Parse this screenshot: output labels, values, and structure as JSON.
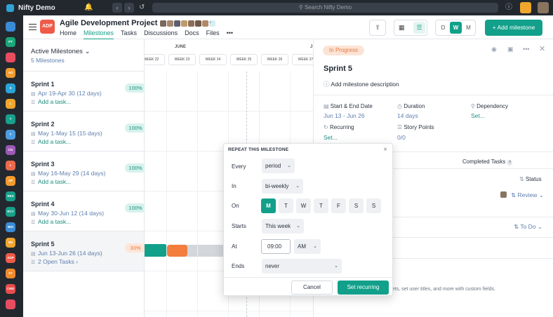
{
  "app": {
    "title": "Nifty Demo",
    "search_placeholder": "Search Nifty Demo"
  },
  "rail": [
    {
      "label": "",
      "color": "#3a8bd6"
    },
    {
      "label": "PT",
      "color": "#1ba679"
    },
    {
      "label": "",
      "color": "#e84c61"
    },
    {
      "label": "AD",
      "color": "#f09b2d"
    },
    {
      "label": "S",
      "color": "#2aa4d6"
    },
    {
      "label": "L",
      "color": "#f0a52d"
    },
    {
      "label": "T",
      "color": "#17a08a"
    },
    {
      "label": "Y",
      "color": "#4d9de0"
    },
    {
      "label": "CG",
      "color": "#9b59b6"
    },
    {
      "label": "L",
      "color": "#ec6a4c"
    },
    {
      "label": "AP",
      "color": "#f39a2d"
    },
    {
      "label": "RES",
      "color": "#17a08a"
    },
    {
      "label": "RCY",
      "color": "#17a08a"
    },
    {
      "label": "BDI",
      "color": "#3a8bd6"
    },
    {
      "label": "ND",
      "color": "#f0a52d"
    },
    {
      "label": "ADP",
      "color": "#ef5a49"
    },
    {
      "label": "ST",
      "color": "#f08a2d"
    },
    {
      "label": "CWD",
      "color": "#e84c4c"
    },
    {
      "label": "",
      "color": "#e84c61"
    }
  ],
  "project": {
    "badge": "ADP",
    "title": "Agile Development Project",
    "tabs": [
      "Home",
      "Milestones",
      "Tasks",
      "Discussions",
      "Docs",
      "Files"
    ],
    "more": "•••"
  },
  "toolbar": {
    "view_d": "D",
    "view_w": "W",
    "view_m": "M",
    "add_milestone": "+ Add milestone"
  },
  "milestones": {
    "title": "Active Milestones",
    "count": "5 Milestones",
    "items": [
      {
        "name": "Sprint 1",
        "dates": "Apr 19-Apr 30 (12 days)",
        "task": "Add a task...",
        "pct": "100%"
      },
      {
        "name": "Sprint 2",
        "dates": "May 1-May 15 (15 days)",
        "task": "Add a task...",
        "pct": "100%"
      },
      {
        "name": "Sprint 3",
        "dates": "May 16-May 29 (14 days)",
        "task": "Add a task...",
        "pct": "100%"
      },
      {
        "name": "Sprint 4",
        "dates": "May 30-Jun 12 (14 days)",
        "task": "Add a task...",
        "pct": "100%"
      },
      {
        "name": "Sprint 5",
        "dates": "Jun 13-Jun 26 (14 days)",
        "task": "2 Open Tasks",
        "pct": "33%"
      }
    ]
  },
  "timeline": {
    "months": [
      "JUNE",
      "J"
    ],
    "weeks": [
      "WEEK 22",
      "WEEK 23",
      "WEEK 24",
      "WEEK 25",
      "WEEK 26",
      "WEEK 27"
    ]
  },
  "panel": {
    "status": "In Progress",
    "title": "Sprint 5",
    "description": "Add milestone description",
    "start_end_label": "Start & End Date",
    "start_end_value": "Jun 13 - Jun 26",
    "duration_label": "Duration",
    "duration_value": "14 days",
    "dependency_label": "Dependency",
    "dependency_value": "Set...",
    "recurring_label": "Recurring",
    "recurring_value": "Set...",
    "story_points_label": "Story Points",
    "story_points_value": "0/0",
    "completed_tasks": "Completed Tasks",
    "status_sort": "Status",
    "review": "Review",
    "todo": "To Do",
    "footer_hint": "gets, set user titles, and more with custom fields."
  },
  "modal": {
    "title": "REPEAT THIS MILESTONE",
    "every_label": "Every",
    "every_value": "period",
    "in_label": "In",
    "in_value": "bi-weekly",
    "on_label": "On",
    "days": [
      "M",
      "T",
      "W",
      "T",
      "F",
      "S",
      "S"
    ],
    "starts_label": "Starts",
    "starts_value": "This week",
    "at_label": "At",
    "at_time": "09:00",
    "at_ampm": "AM",
    "ends_label": "Ends",
    "ends_value": "never",
    "cancel": "Cancel",
    "submit": "Set recurring"
  }
}
